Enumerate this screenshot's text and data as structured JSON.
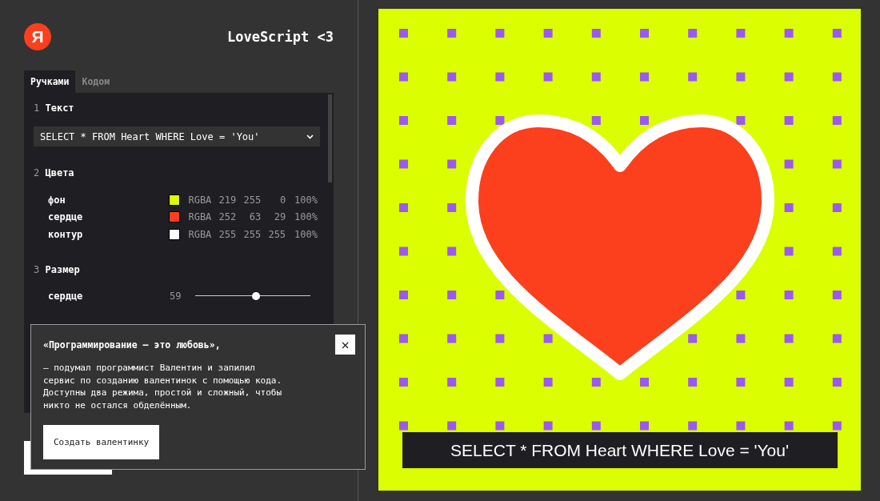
{
  "header": {
    "logo": "Я",
    "title": "LoveScript <3"
  },
  "tabs": [
    {
      "label": "Ручками",
      "selected": true
    },
    {
      "label": "Кодом",
      "selected": false
    }
  ],
  "sections": [
    {
      "number": "1",
      "title": "Текст",
      "kind": "select",
      "value": "SELECT * FROM Heart WHERE Love = 'You'"
    },
    {
      "number": "2",
      "title": "Цвета",
      "kind": "colors",
      "items": [
        {
          "label": "фон",
          "color": "#dbff00",
          "model": "RGBA",
          "channels": [
            "219",
            "255",
            "0",
            "100%"
          ]
        },
        {
          "label": "сердце",
          "color": "#fc3f1d",
          "model": "RGBA",
          "channels": [
            "252",
            "63",
            "29",
            "100%"
          ]
        },
        {
          "label": "контур",
          "color": "#ffffff",
          "model": "RGBA",
          "channels": [
            "255",
            "255",
            "255",
            "100%"
          ]
        }
      ]
    },
    {
      "number": "3",
      "title": "Размер",
      "kind": "sliders",
      "items": [
        {
          "label": "сердце",
          "value": "59",
          "level": 0.53
        }
      ]
    }
  ],
  "popup": {
    "title": "«Программирование — это любовь»,",
    "lines": [
      "— подумал программист Валентин и запилил",
      "сервис по созданию валентинок с помощью кода.",
      "Доступны два режима, простой и сложный, чтобы",
      "никто не остался обделённым."
    ],
    "button": "Создать валентинку",
    "close": "×"
  },
  "preview": {
    "caption": "SELECT * FROM Heart WHERE Love = 'You'"
  }
}
